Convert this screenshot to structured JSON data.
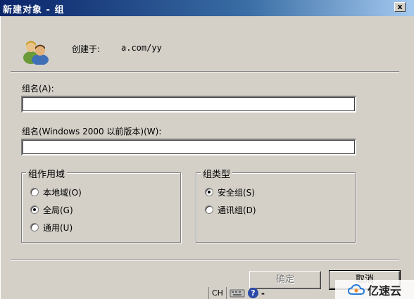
{
  "window": {
    "title": "新建对象 - 组",
    "close_glyph": "x"
  },
  "header": {
    "created_label": "创建于:",
    "created_value": "a.com/yy"
  },
  "fields": {
    "group_name": {
      "label": "组名(A):",
      "value": ""
    },
    "group_name_pre2000": {
      "label": "组名(Windows 2000 以前版本)(W):",
      "value": ""
    }
  },
  "scope": {
    "title": "组作用域",
    "options": [
      {
        "label": "本地域(O)",
        "checked": false
      },
      {
        "label": "全局(G)",
        "checked": true
      },
      {
        "label": "通用(U)",
        "checked": false
      }
    ]
  },
  "type": {
    "title": "组类型",
    "options": [
      {
        "label": "安全组(S)",
        "checked": true
      },
      {
        "label": "通讯组(D)",
        "checked": false
      }
    ]
  },
  "buttons": {
    "ok_label": "确定",
    "cancel_label": "取消"
  },
  "langbar": {
    "lang": "CH",
    "help": "?",
    "dash": "-"
  },
  "watermark": {
    "text": "亿速云",
    "icon": "cloud-logo-icon"
  },
  "icons": {
    "group": "group-users-icon",
    "close": "close-icon",
    "keyboard": "keyboard-icon",
    "help": "help-icon"
  },
  "colors": {
    "dialog_bg": "#d4d0c8",
    "titlebar_start": "#0a246a",
    "titlebar_end": "#a6caf0"
  }
}
